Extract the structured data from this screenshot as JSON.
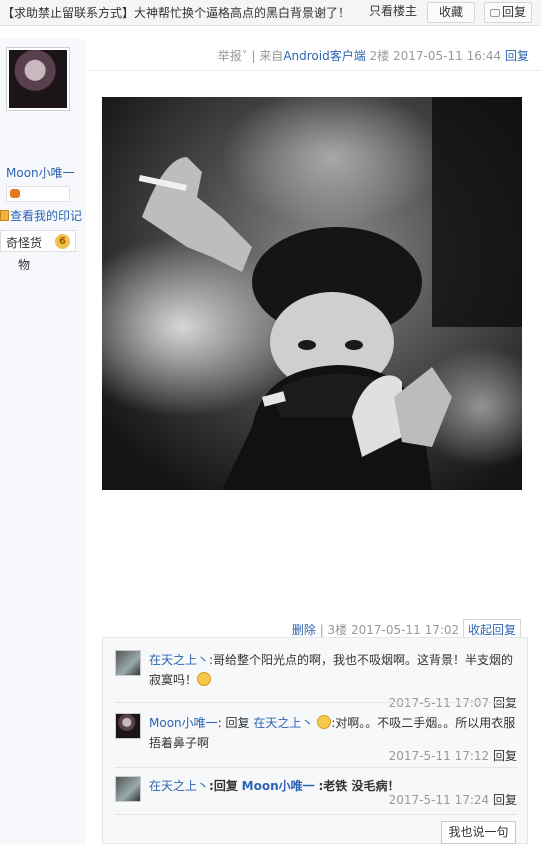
{
  "topbar": {
    "title": "【求助禁止留联系方式】大神帮忙换个逼格高点的黑白背景谢了！",
    "only_op_label": "只看楼主",
    "favorite_label": "收藏",
    "reply_label": "回复"
  },
  "floor2": {
    "report": "举报",
    "source_prefix": "| 来自",
    "source_app": "Android客户端",
    "floor": "2楼",
    "time": "2017-05-11 16:44",
    "reply": "回复"
  },
  "user": {
    "name": "Moon小唯一",
    "mark_link": "查看我的印记",
    "level_name_1": "奇怪货",
    "level_name_2": "物",
    "level_num": "6"
  },
  "floor3": {
    "delete": "删除",
    "floor": "| 3楼",
    "time": "2017-05-11 17:02",
    "collapse": "收起回复"
  },
  "comments": [
    {
      "author": "在天之上丶",
      "text": ":哥给整个阳光点的啊，我也不吸烟啊。这背景！半支烟的寂寞吗！",
      "time": "2017-5-11 17:07",
      "reply": "回复"
    },
    {
      "author": "Moon小唯一",
      "reply_word": ": 回复",
      "target": "在天之上丶",
      "text": ":对啊。。不吸二手烟。。所以用衣服捂着鼻子啊",
      "time": "2017-5-11 17:12",
      "reply": "回复"
    },
    {
      "author": "在天之上丶",
      "reply_word": ":回复",
      "target": "Moon小唯一",
      "text": ":老铁 没毛病！",
      "time": "2017-5-11 17:24",
      "reply": "回复"
    }
  ],
  "say_button": "我也说一句",
  "colors": {
    "link": "#2d64b3",
    "meta": "#999999",
    "sidebar": "#f6f8fb"
  }
}
